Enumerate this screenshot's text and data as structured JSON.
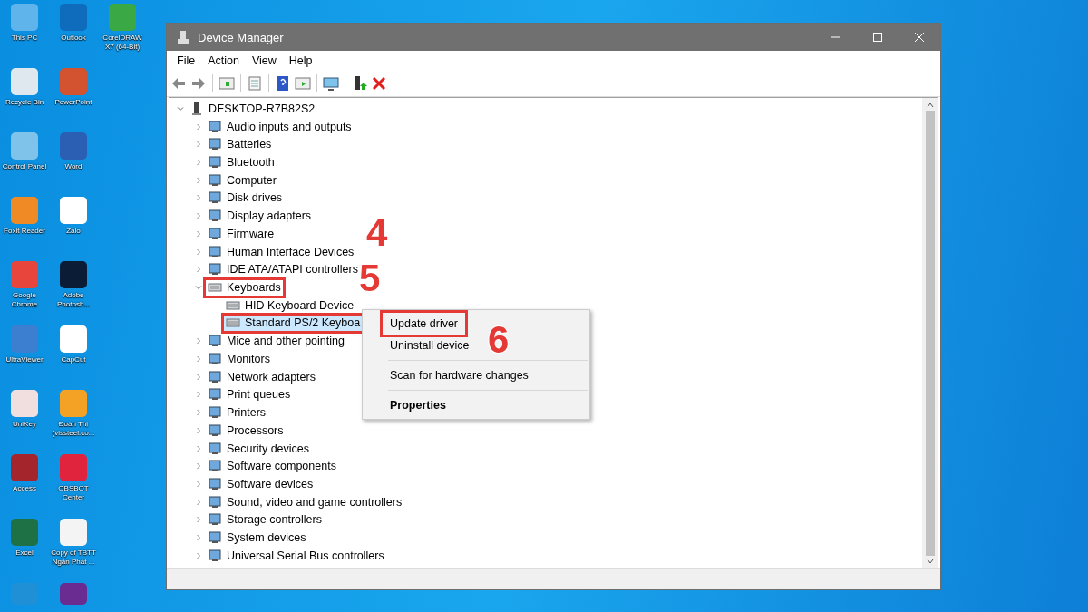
{
  "desktop_icons": [
    {
      "label": "This PC",
      "color": "#5fb4ec"
    },
    {
      "label": "Recycle Bin",
      "color": "#dfe8ee"
    },
    {
      "label": "Control Panel",
      "color": "#7fc3ea"
    },
    {
      "label": "Foxit Reader",
      "color": "#f08a24"
    },
    {
      "label": "Google Chrome",
      "color": "#e8453c"
    },
    {
      "label": "UltraViewer",
      "color": "#3c7fd0"
    },
    {
      "label": "UniKey",
      "color": "#f1dede"
    },
    {
      "label": "Access",
      "color": "#a4262c"
    },
    {
      "label": "Excel",
      "color": "#1e7145"
    },
    {
      "color": "#1f8fd6"
    },
    {
      "label": "Outlook",
      "color": "#0f6cbd"
    },
    {
      "label": "PowerPoint",
      "color": "#d35230"
    },
    {
      "label": "Word",
      "color": "#2b5fb4"
    },
    {
      "label": "Zalo",
      "color": "#ffffff"
    },
    {
      "label": "Adobe Photosh...",
      "color": "#0b1d36"
    },
    {
      "label": "CapCut",
      "color": "#ffffff"
    },
    {
      "label": "Đoàn Thị (vissteel.co...",
      "color": "#f3a226"
    },
    {
      "label": "OBSBOT Center",
      "color": "#e0243d"
    },
    {
      "label": "Copy of TBTT Ngân Phát ...",
      "color": "#f4f4f4"
    },
    {
      "color": "#6b2c91"
    },
    {
      "label": "CorelDRAW X7 (64-Bit)",
      "color": "#3aa845"
    }
  ],
  "window": {
    "title": "Device Manager"
  },
  "menu": [
    "File",
    "Action",
    "View",
    "Help"
  ],
  "tree": {
    "label": "DESKTOP-R7B82S2",
    "expanded": true,
    "children": [
      {
        "label": "Audio inputs and outputs",
        "expanded": false,
        "marked": false
      },
      {
        "label": "Batteries",
        "expanded": false,
        "marked": false
      },
      {
        "label": "Bluetooth",
        "expanded": false,
        "marked": false
      },
      {
        "label": "Computer",
        "expanded": false,
        "marked": false
      },
      {
        "label": "Disk drives",
        "expanded": false,
        "marked": false
      },
      {
        "label": "Display adapters",
        "expanded": false,
        "marked": false
      },
      {
        "label": "Firmware",
        "expanded": false,
        "marked": false
      },
      {
        "label": "Human Interface Devices",
        "expanded": false,
        "marked": false
      },
      {
        "label": "IDE ATA/ATAPI controllers",
        "expanded": false,
        "marked": false
      },
      {
        "label": "Keyboards",
        "expanded": true,
        "marked": true,
        "children": [
          {
            "label": "HID Keyboard Device",
            "selected": false,
            "marked": false
          },
          {
            "label": "Standard PS/2 Keyboa",
            "selected": true,
            "marked": true
          }
        ]
      },
      {
        "label": "Mice and other pointing",
        "expanded": false,
        "marked": false
      },
      {
        "label": "Monitors",
        "expanded": false,
        "marked": false
      },
      {
        "label": "Network adapters",
        "expanded": false,
        "marked": false
      },
      {
        "label": "Print queues",
        "expanded": false,
        "marked": false
      },
      {
        "label": "Printers",
        "expanded": false,
        "marked": false
      },
      {
        "label": "Processors",
        "expanded": false,
        "marked": false
      },
      {
        "label": "Security devices",
        "expanded": false,
        "marked": false
      },
      {
        "label": "Software components",
        "expanded": false,
        "marked": false
      },
      {
        "label": "Software devices",
        "expanded": false,
        "marked": false
      },
      {
        "label": "Sound, video and game controllers",
        "expanded": false,
        "marked": false
      },
      {
        "label": "Storage controllers",
        "expanded": false,
        "marked": false
      },
      {
        "label": "System devices",
        "expanded": false,
        "marked": false
      },
      {
        "label": "Universal Serial Bus controllers",
        "expanded": false,
        "marked": false
      }
    ]
  },
  "context_menu": [
    {
      "label": "Update driver",
      "kind": "item",
      "marked": true
    },
    {
      "label": "Uninstall device",
      "kind": "item",
      "marked": false
    },
    {
      "label": "Scan for hardware changes",
      "kind": "item",
      "marked": false
    },
    {
      "label": "Properties",
      "kind": "default",
      "marked": false
    }
  ],
  "callouts": [
    "4",
    "5",
    "6"
  ]
}
